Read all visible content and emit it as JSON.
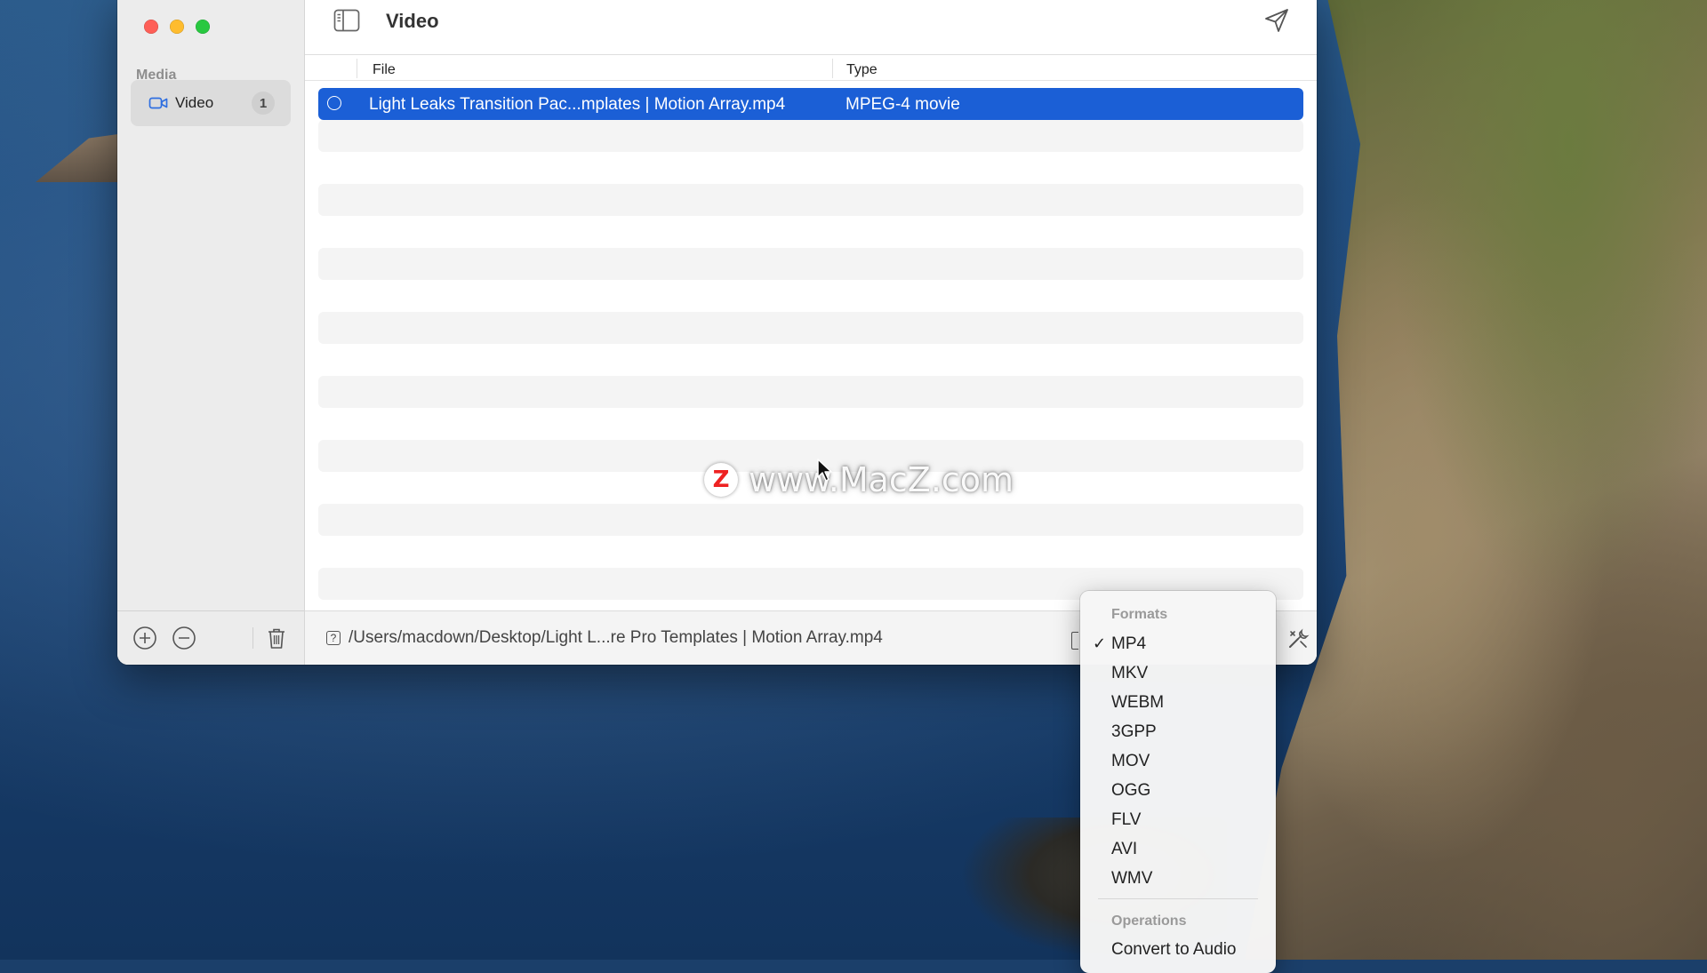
{
  "window": {
    "title": "Video",
    "sidebar": {
      "section_label": "Media",
      "items": [
        {
          "label": "Video",
          "count": "1",
          "icon": "video-camera-icon"
        }
      ]
    },
    "columns": {
      "file": "File",
      "type": "Type"
    },
    "rows": [
      {
        "file": "Light Leaks Transition Pac...mplates | Motion Array.mp4",
        "type": "MPEG-4 movie",
        "selected": true
      }
    ],
    "status_path": "/Users/macdown/Desktop/Light L...re Pro Templates | Motion Array.mp4"
  },
  "watermark": {
    "badge": "Z",
    "text": "www.MacZ.com"
  },
  "format_menu": {
    "formats_header": "Formats",
    "formats": [
      "MP4",
      "MKV",
      "WEBM",
      "3GPP",
      "MOV",
      "OGG",
      "FLV",
      "AVI",
      "WMV"
    ],
    "selected_format": "MP4",
    "check_mark": "✓",
    "operations_header": "Operations",
    "operations": [
      "Convert to Audio"
    ]
  },
  "colors": {
    "selection": "#1b5fd6",
    "close": "#fe5f57",
    "minimize": "#febc2e",
    "zoom": "#28c840"
  }
}
